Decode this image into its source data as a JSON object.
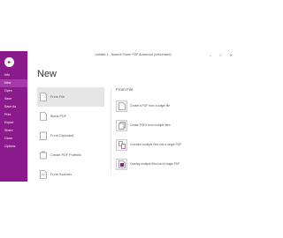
{
  "window": {
    "title": "Untitled-1 - Nuance Power PDF Advanced (Unlicensed)",
    "controls": "– □ ✕"
  },
  "sidebar": {
    "back_icon": "back-arrow-icon",
    "items": [
      {
        "label": "Info",
        "active": false
      },
      {
        "label": "New",
        "active": true
      },
      {
        "label": "Open",
        "active": false
      },
      {
        "label": "Save",
        "active": false
      },
      {
        "label": "Save As",
        "active": false
      },
      {
        "label": "Print",
        "active": false
      },
      {
        "label": "Export",
        "active": false
      },
      {
        "label": "Share",
        "active": false
      },
      {
        "label": "Close",
        "active": false
      },
      {
        "label": "Options",
        "active": false
      }
    ]
  },
  "main": {
    "title": "New",
    "items": [
      {
        "label": "From File",
        "icon": "document-icon",
        "active": true
      },
      {
        "label": "Blank PDF",
        "icon": "blank-document-icon",
        "active": false
      },
      {
        "label": "From Clipboard",
        "icon": "clipboard-icon",
        "active": false
      },
      {
        "label": "Create PDF Portfolio",
        "icon": "portfolio-icon",
        "active": false
      },
      {
        "label": "From Scanner",
        "icon": "scanner-icon",
        "active": false
      }
    ]
  },
  "right_panel": {
    "title": "From File",
    "items": [
      {
        "label": "Create a PDF from a single file",
        "icon": "single-file-icon"
      },
      {
        "label": "Create PDFs from multiple files",
        "icon": "multiple-files-icon"
      },
      {
        "label": "Combine multiple files into a single PDF",
        "icon": "combine-files-icon"
      },
      {
        "label": "Overlay multiple files into a single PDF",
        "icon": "overlay-files-icon"
      }
    ]
  },
  "colors": {
    "sidebar": "#8b1a8b",
    "sidebar_active": "#a63aa6",
    "accent": "#8b1a8b"
  }
}
